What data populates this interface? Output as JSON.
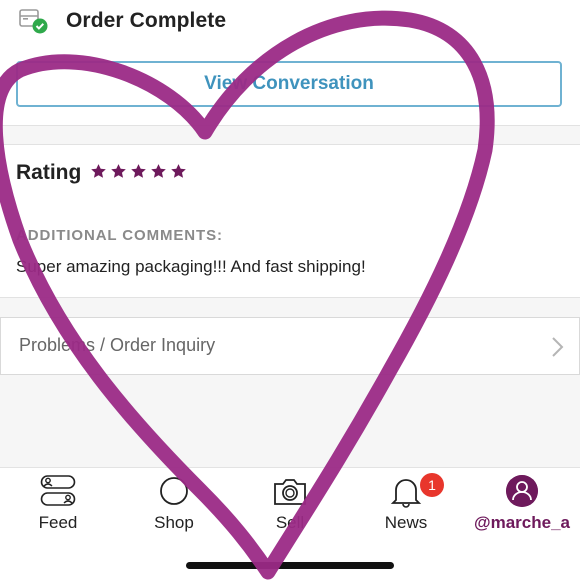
{
  "order": {
    "status_title": "Order Complete",
    "view_conversation_label": "View Conversation"
  },
  "rating": {
    "label": "Rating",
    "stars": 5,
    "max_stars": 5,
    "star_color": "#6e1a5c"
  },
  "comments": {
    "heading": "ADDITIONAL COMMENTS:",
    "text": "Super amazing packaging!!! And fast shipping!"
  },
  "inquiry": {
    "label": "Problems / Order Inquiry"
  },
  "tabbar": {
    "items": [
      {
        "label": "Feed",
        "icon": "feed-icon"
      },
      {
        "label": "Shop",
        "icon": "shop-icon"
      },
      {
        "label": "Sell",
        "icon": "camera-icon"
      },
      {
        "label": "News",
        "icon": "bell-icon",
        "badge": "1"
      },
      {
        "label": "@marche_a",
        "icon": "avatar-icon",
        "active": true
      }
    ]
  },
  "colors": {
    "accent": "#6e1a5c",
    "link_blue": "#3f93bd",
    "badge_red": "#e8362c",
    "heart_drawing": "#9b2a86"
  }
}
